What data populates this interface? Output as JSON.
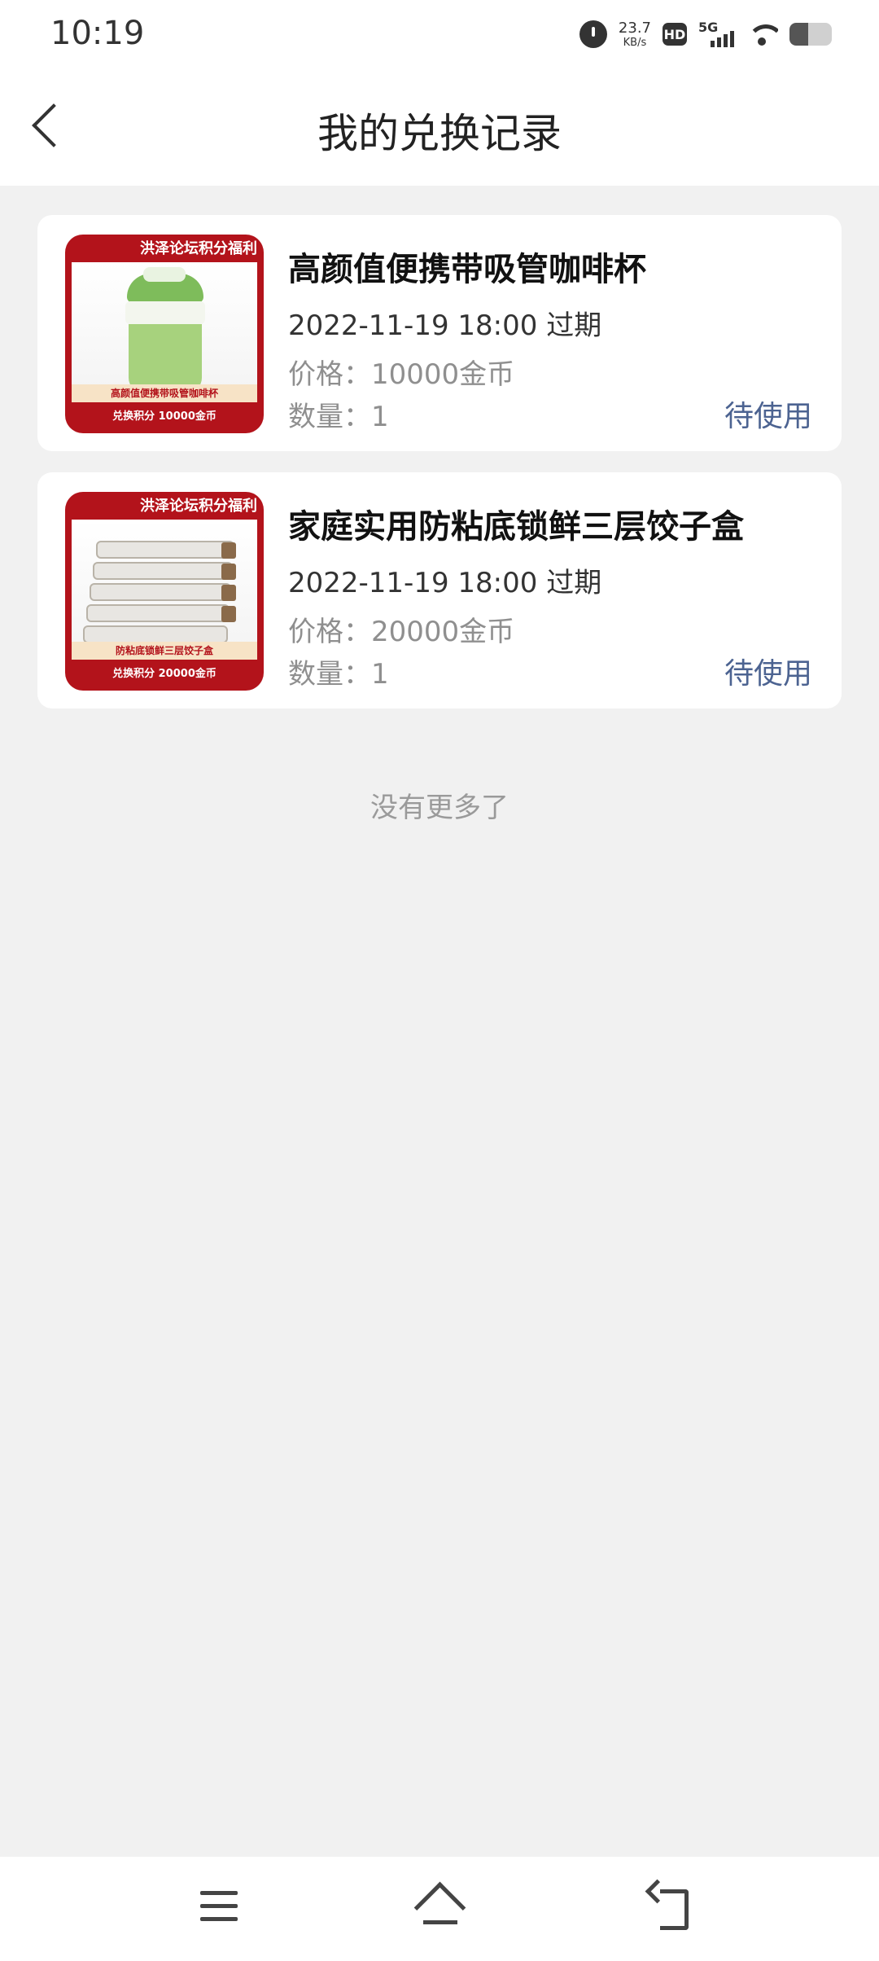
{
  "status_bar": {
    "time": "10:19",
    "net_speed": "23.7",
    "net_speed_unit": "KB/s",
    "hd_label": "HD",
    "signal_label": "5G",
    "battery_level": 0.45
  },
  "header": {
    "title": "我的兑换记录"
  },
  "records": [
    {
      "title": "高颜值便携带吸管咖啡杯",
      "expire": "2022-11-19 18:00 过期",
      "price": "价格：10000金币",
      "quantity": "数量：1",
      "status": "待使用",
      "image_banner": "洪泽论坛积分福利",
      "image_caption": "高颜值便携带吸管咖啡杯",
      "image_price": "兑换积分 10000金币"
    },
    {
      "title": "家庭实用防粘底锁鲜三层饺子盒",
      "expire": "2022-11-19 18:00 过期",
      "price": "价格：20000金币",
      "quantity": "数量：1",
      "status": "待使用",
      "image_banner": "洪泽论坛积分福利",
      "image_caption": "防粘底锁鲜三层饺子盒",
      "image_price": "兑换积分 20000金币"
    }
  ],
  "footer": {
    "no_more": "没有更多了"
  }
}
